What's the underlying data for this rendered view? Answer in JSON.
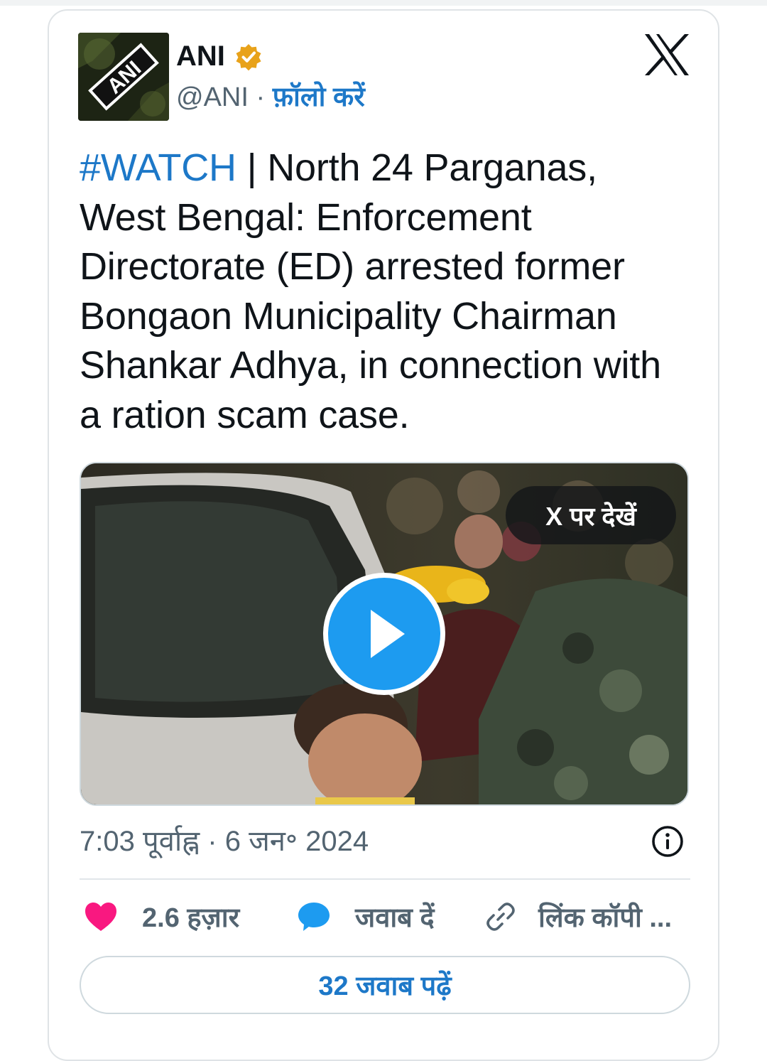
{
  "author": {
    "display_name": "ANI",
    "handle": "@ANI",
    "separator": "·",
    "follow_label": "फ़ॉलो करें",
    "avatar_icon": "ani-logo-icon",
    "avatar_text": "ANI",
    "verified_icon": "verified-badge-icon",
    "verified_color": "#e8a21a"
  },
  "tweet": {
    "hashtag": "#WATCH",
    "body": " | North 24 Parganas, West Bengal: Enforcement Directorate (ED) arrested former Bongaon Municipality Chairman Shankar Adhya, in connection with a ration scam case."
  },
  "media": {
    "view_on_x_label": "X पर देखें",
    "play_icon": "play-icon",
    "play_color": "#1d9bf0"
  },
  "meta": {
    "timestamp": "7:03 पूर्वाह्न · 6 जन॰ 2024",
    "info_icon": "info-icon"
  },
  "actions": {
    "like_count": "2.6 हज़ार",
    "like_icon": "heart-icon",
    "like_color": "#f91880",
    "reply_label": "जवाब दें",
    "reply_icon": "speech-bubble-icon",
    "reply_color": "#1d9bf0",
    "copy_label": "लिंक कॉपी ...",
    "copy_icon": "link-icon"
  },
  "footer": {
    "read_replies_label": "32 जवाब पढ़ें"
  },
  "colors": {
    "accent": "#1d78c8",
    "text": "#0f1419",
    "secondary": "#536471"
  },
  "brand": {
    "logo_icon": "x-logo-icon"
  }
}
